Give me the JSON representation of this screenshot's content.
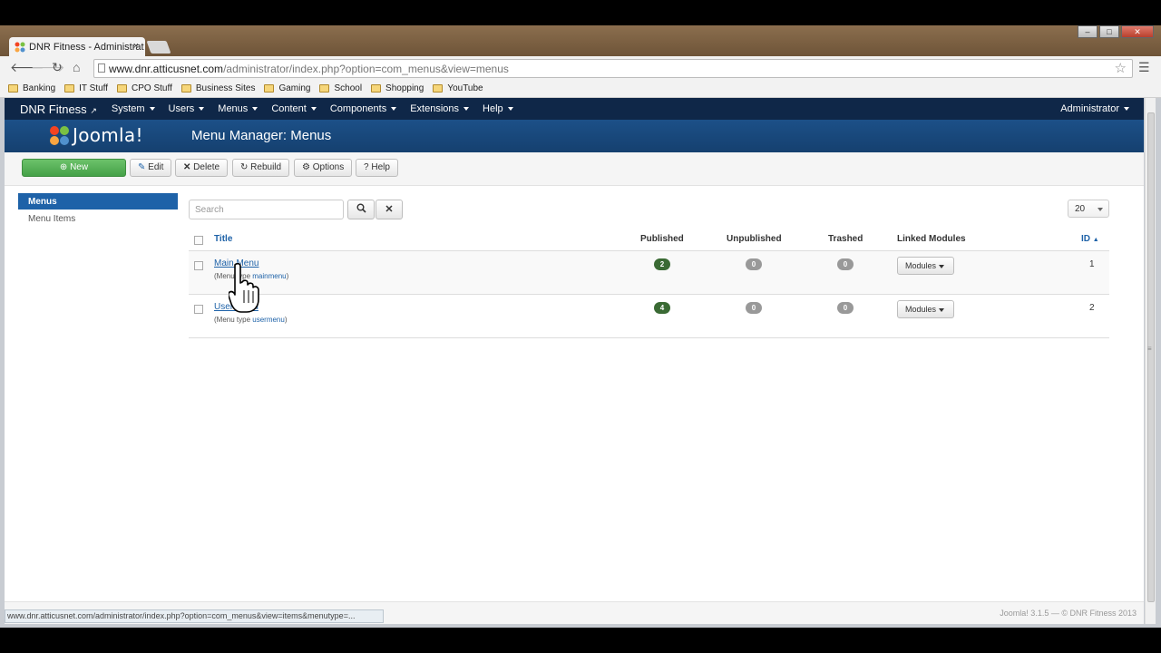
{
  "browser": {
    "tab_title": "DNR Fitness - Administrat",
    "tab_close": "×",
    "url_host": "www.dnr.atticusnet.com",
    "url_path": "/administrator/index.php?option=com_menus&view=menus",
    "bookmarks": [
      "Banking",
      "IT Stuff",
      "CPO Stuff",
      "Business Sites",
      "Gaming",
      "School",
      "Shopping",
      "YouTube"
    ],
    "status_url": "www.dnr.atticusnet.com/administrator/index.php?option=com_menus&view=items&menutype=..."
  },
  "navbar": {
    "brand": "DNR Fitness",
    "items": [
      "System",
      "Users",
      "Menus",
      "Content",
      "Components",
      "Extensions",
      "Help"
    ],
    "user": "Administrator"
  },
  "header": {
    "logo": "Joomla!",
    "title": "Menu Manager: Menus"
  },
  "toolbar": {
    "new": "New",
    "edit": "Edit",
    "delete": "Delete",
    "rebuild": "Rebuild",
    "options": "Options",
    "help": "Help"
  },
  "sidebar": {
    "active": "Menus",
    "items": [
      "Menu Items"
    ]
  },
  "filter": {
    "search_placeholder": "Search",
    "limit": "20"
  },
  "table": {
    "headers": {
      "title": "Title",
      "published": "Published",
      "unpublished": "Unpublished",
      "trashed": "Trashed",
      "linked": "Linked Modules",
      "id": "ID"
    },
    "rows": [
      {
        "title": "Main Menu",
        "type_label": "(Menu type ",
        "type_value": "mainmenu",
        "type_close": ")",
        "published": "2",
        "unpublished": "0",
        "trashed": "0",
        "modules": "Modules",
        "id": "1"
      },
      {
        "title": "User Menu",
        "type_label": "(Menu type ",
        "type_value": "usermenu",
        "type_close": ")",
        "published": "4",
        "unpublished": "0",
        "trashed": "0",
        "modules": "Modules",
        "id": "2"
      }
    ]
  },
  "footer": "Joomla! 3.1.5 — © DNR Fitness 2013",
  "colors": {
    "navbar": "#0f2748",
    "header": "#1c5088",
    "primary": "#1e62a8",
    "success": "#45a148",
    "badge_published": "#3a6a34"
  }
}
